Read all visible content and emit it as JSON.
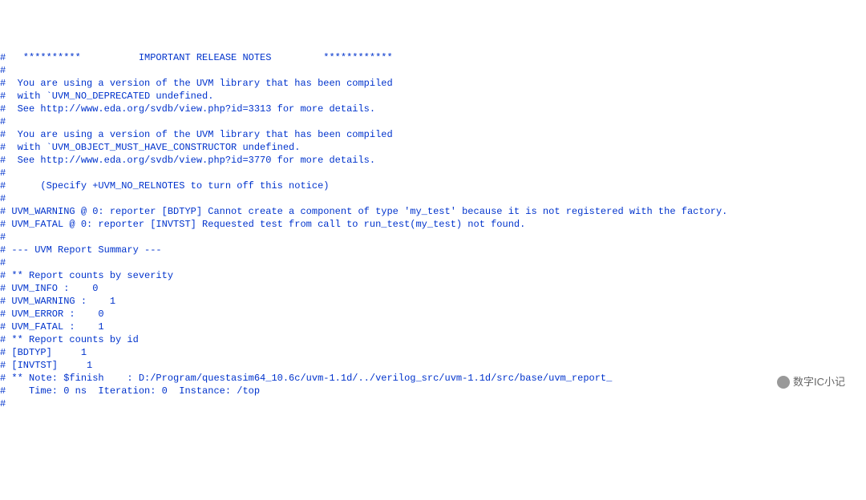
{
  "lines": [
    "#   **********          IMPORTANT RELEASE NOTES         ************",
    "#",
    "#  You are using a version of the UVM library that has been compiled",
    "#  with `UVM_NO_DEPRECATED undefined.",
    "#  See http://www.eda.org/svdb/view.php?id=3313 for more details.",
    "#",
    "#  You are using a version of the UVM library that has been compiled",
    "#  with `UVM_OBJECT_MUST_HAVE_CONSTRUCTOR undefined.",
    "#  See http://www.eda.org/svdb/view.php?id=3770 for more details.",
    "#",
    "#      (Specify +UVM_NO_RELNOTES to turn off this notice)",
    "#",
    "# UVM_WARNING @ 0: reporter [BDTYP] Cannot create a component of type 'my_test' because it is not registered with the factory.",
    "# UVM_FATAL @ 0: reporter [INVTST] Requested test from call to run_test(my_test) not found.",
    "#",
    "# --- UVM Report Summary ---",
    "#",
    "# ** Report counts by severity",
    "# UVM_INFO :    0",
    "# UVM_WARNING :    1",
    "# UVM_ERROR :    0",
    "# UVM_FATAL :    1",
    "# ** Report counts by id",
    "# [BDTYP]     1",
    "# [INVTST]     1",
    "# ** Note: $finish    : D:/Program/questasim64_10.6c/uvm-1.1d/../verilog_src/uvm-1.1d/src/base/uvm_report_",
    "#    Time: 0 ns  Iteration: 0  Instance: /top",
    "# "
  ],
  "watermark": "数字IC小记"
}
